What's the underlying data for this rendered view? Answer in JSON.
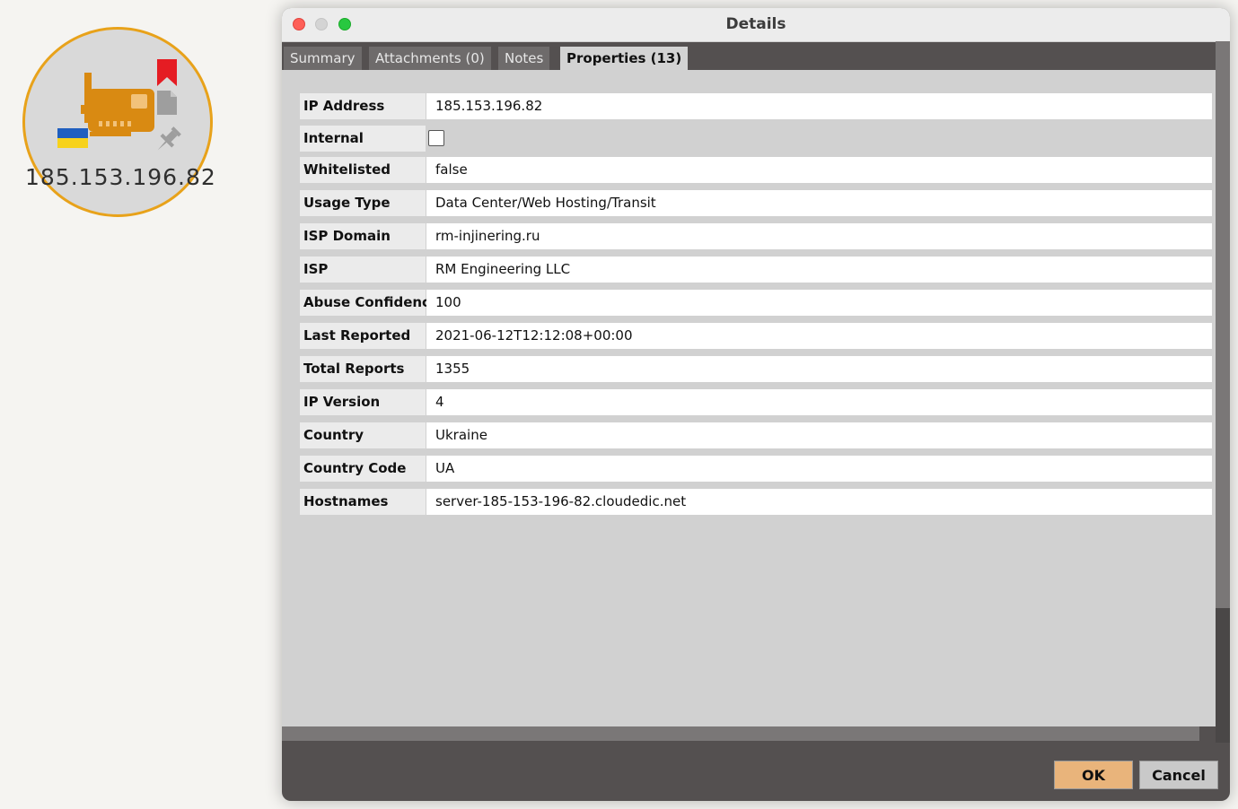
{
  "node": {
    "label": "185.153.196.82",
    "icon": "network-card-icon",
    "border_color": "#e8a21a",
    "badges": [
      "bookmark-icon",
      "document-icon",
      "pin-icon",
      "ukraine-flag-icon"
    ]
  },
  "dialog": {
    "title": "Details",
    "tabs": [
      {
        "label": "Summary",
        "active": false
      },
      {
        "label": "Attachments (0)",
        "active": false
      },
      {
        "label": "Notes",
        "active": false
      },
      {
        "label": "Properties (13)",
        "active": true
      }
    ],
    "properties": [
      {
        "label": "IP Address",
        "value": "185.153.196.82"
      },
      {
        "label": "Internal",
        "value": null,
        "checkbox": false
      },
      {
        "label": "Whitelisted",
        "value": "false"
      },
      {
        "label": "Usage Type",
        "value": "Data Center/Web Hosting/Transit"
      },
      {
        "label": "ISP Domain",
        "value": "rm-injinering.ru"
      },
      {
        "label": "ISP",
        "value": "RM Engineering LLC"
      },
      {
        "label": "Abuse Confidence",
        "value": "100"
      },
      {
        "label": "Last Reported",
        "value": "2021-06-12T12:12:08+00:00"
      },
      {
        "label": "Total Reports",
        "value": "1355"
      },
      {
        "label": "IP Version",
        "value": "4"
      },
      {
        "label": "Country",
        "value": "Ukraine"
      },
      {
        "label": "Country Code",
        "value": "UA"
      },
      {
        "label": "Hostnames",
        "value": "server-185-153-196-82.cloudedic.net"
      }
    ],
    "buttons": {
      "ok": "OK",
      "cancel": "Cancel"
    },
    "colors": {
      "ok_button": "#e9b47b",
      "accent": "#e8a21a"
    }
  }
}
